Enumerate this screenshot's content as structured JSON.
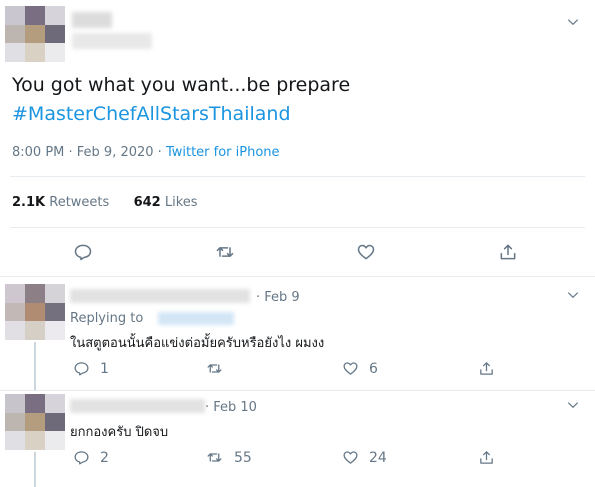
{
  "tweet": {
    "text": "You got what you want...be prepare",
    "hashtag": "#MasterChefAllStarsThailand",
    "datetime": "8:00 PM · Feb 9, 2020 · ",
    "source": "Twitter for iPhone",
    "retweets_count": "2.1K",
    "retweets_label": "Retweets",
    "likes_count": "642",
    "likes_label": "Likes"
  },
  "replies": [
    {
      "date": "· Feb 9",
      "replying_label": "Replying to",
      "text": "ในสตูตอนนั้นคือแข่งต่อมั้ยครับหรือยังไง ผมงง",
      "replies": "1",
      "retweets": "",
      "likes": "6"
    },
    {
      "date": "· Feb 10",
      "text": "ยกกองครับ ปิดจบ",
      "replies": "2",
      "retweets": "55",
      "likes": "24"
    }
  ],
  "colors": {
    "accent": "#1b95e0",
    "secondary_text": "#657786",
    "divider": "#e6ecf0"
  },
  "icons": [
    "chevron-down-icon",
    "reply-icon",
    "retweet-icon",
    "like-icon",
    "share-icon"
  ]
}
